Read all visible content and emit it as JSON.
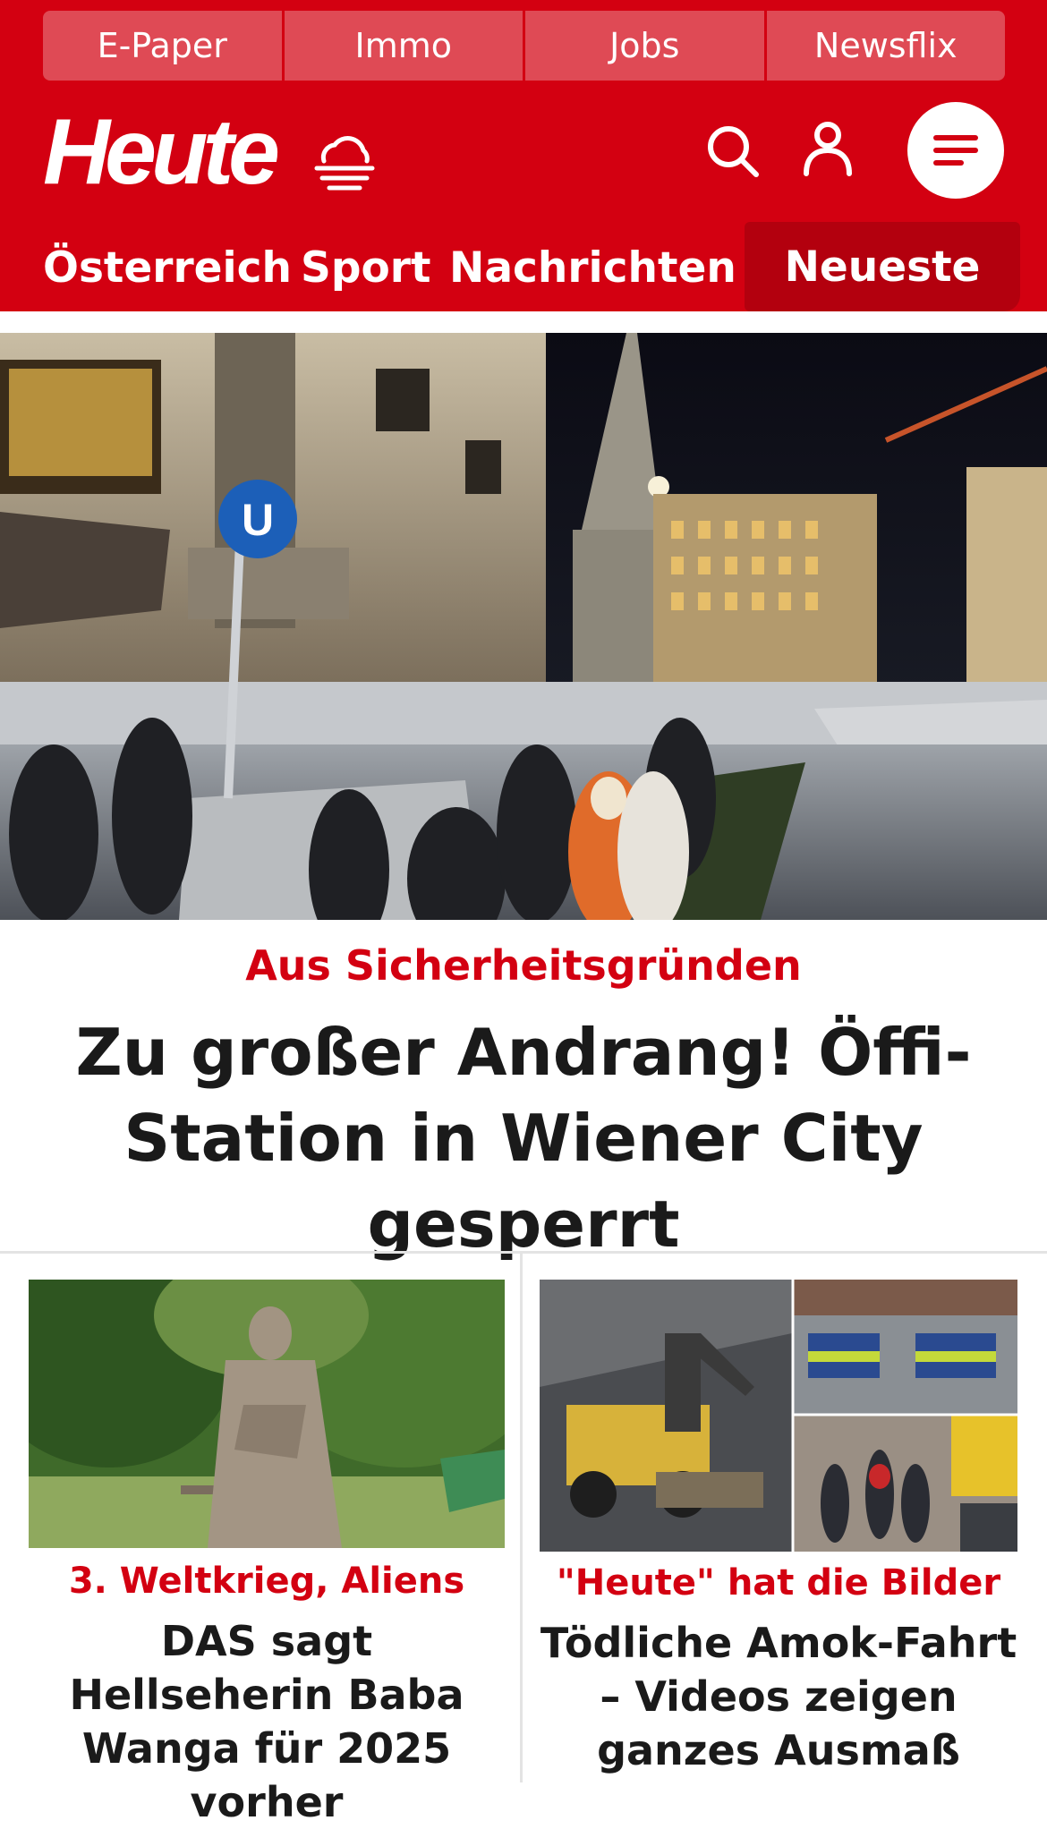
{
  "topnav": [
    "E-Paper",
    "Immo",
    "Jobs",
    "Newsflix"
  ],
  "brand": {
    "logo_text": "Heute",
    "accent_color": "#d30011"
  },
  "header_icons": [
    "weather-icon",
    "search-icon",
    "user-icon",
    "menu-icon"
  ],
  "categories": [
    "Österreich",
    "Sport",
    "Nachrichten",
    "Neueste"
  ],
  "hero": {
    "kicker": "Aus Sicherheitsgründen",
    "title": "Zu großer Andrang! Öffi-Station in Wiener City gesperrt",
    "image_sign_text": "U"
  },
  "cards": [
    {
      "kicker": "3. Weltkrieg, Aliens",
      "title": "DAS sagt Hellseherin Baba Wanga für 2025 vorher"
    },
    {
      "kicker": "\"Heute\" hat die Bilder",
      "title": "Tödliche Amok-Fahrt – Videos zeigen ganzes Ausmaß"
    }
  ]
}
